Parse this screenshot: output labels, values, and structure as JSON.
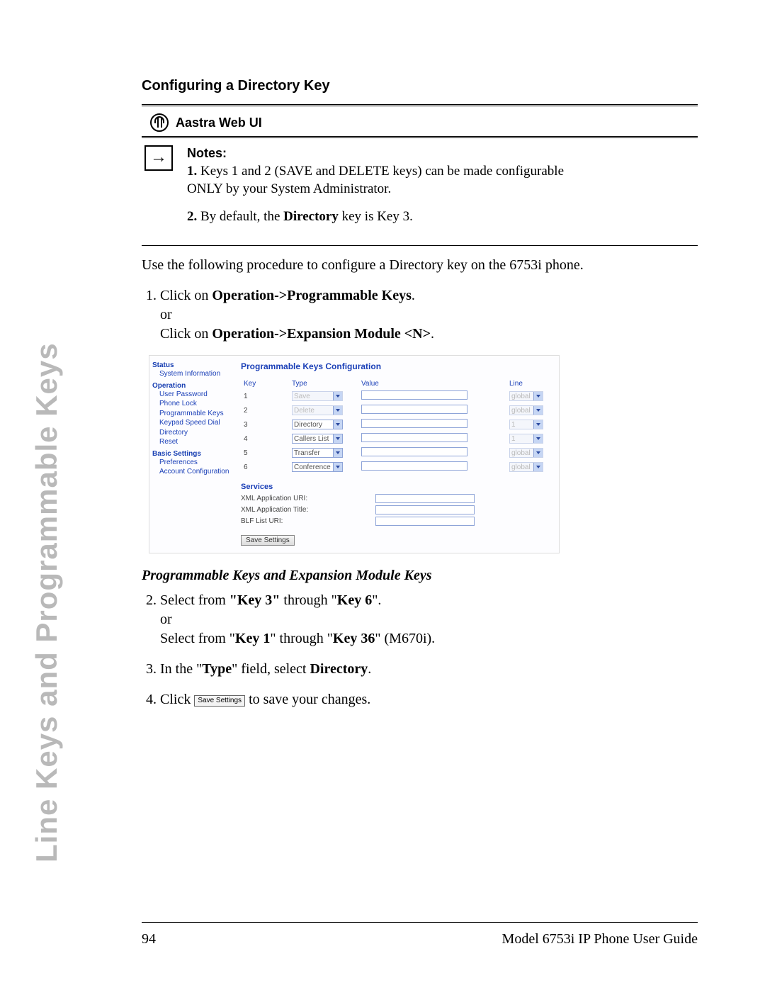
{
  "side_tab": "Line Keys and Programmable Keys",
  "heading": "Configuring a Directory Key",
  "webui_label": "Aastra Web UI",
  "notes": {
    "title": "Notes:",
    "item1_num": "1.",
    "item1_text_a": "Keys 1 and 2 (SAVE and DELETE keys) can be made configurable ONLY by your System Administrator.",
    "item2_num": "2.",
    "item2_text_a": "By default, the ",
    "item2_bold": "Directory",
    "item2_text_b": " key is Key 3."
  },
  "intro": "Use the following procedure to configure a Directory key on the 6753i phone.",
  "step1": {
    "a": "Click on ",
    "b": "Operation->Programmable Keys",
    "c": ".",
    "or": "or",
    "d": "Click on ",
    "e": "Operation->Expansion Module <N>",
    "f": "."
  },
  "webui": {
    "title": "Programmable Keys Configuration",
    "nav": {
      "status": "Status",
      "status_items": [
        "System Information"
      ],
      "operation": "Operation",
      "operation_items": [
        "User Password",
        "Phone Lock",
        "Programmable Keys",
        "Keypad Speed Dial",
        "Directory",
        "Reset"
      ],
      "basic": "Basic Settings",
      "basic_items": [
        "Preferences",
        "Account Configuration"
      ]
    },
    "cols": {
      "key": "Key",
      "type": "Type",
      "value": "Value",
      "line": "Line"
    },
    "rows": [
      {
        "k": "1",
        "type": "Save",
        "type_disabled": true,
        "line": "global",
        "line_disabled": true
      },
      {
        "k": "2",
        "type": "Delete",
        "type_disabled": true,
        "line": "global",
        "line_disabled": true
      },
      {
        "k": "3",
        "type": "Directory",
        "type_disabled": false,
        "line": "1",
        "line_disabled": true
      },
      {
        "k": "4",
        "type": "Callers List",
        "type_disabled": false,
        "line": "1",
        "line_disabled": true
      },
      {
        "k": "5",
        "type": "Transfer",
        "type_disabled": false,
        "line": "global",
        "line_disabled": true
      },
      {
        "k": "6",
        "type": "Conference",
        "type_disabled": false,
        "line": "global",
        "line_disabled": true
      }
    ],
    "services_title": "Services",
    "services": [
      "XML Application URI:",
      "XML Application Title:",
      "BLF List URI:"
    ],
    "save_btn": "Save Settings"
  },
  "subheading": "Programmable Keys and Expansion Module Keys",
  "step2": {
    "a": "Select from ",
    "b": "\"Key 3\"",
    "c": " through \"",
    "d": "Key 6",
    "e": "\".",
    "or": "or",
    "f": "Select from \"",
    "g": "Key 1",
    "h": "\" through \"",
    "i": "Key 36",
    "j": "\" (M670i)."
  },
  "step3": {
    "a": "In the \"",
    "b": "Type",
    "c": "\" field, select ",
    "d": "Directory",
    "e": "."
  },
  "step4": {
    "a": "Click ",
    "btn": "Save Settings",
    "b": " to save your changes."
  },
  "footer": {
    "page": "94",
    "title": "Model 6753i IP Phone User Guide"
  }
}
